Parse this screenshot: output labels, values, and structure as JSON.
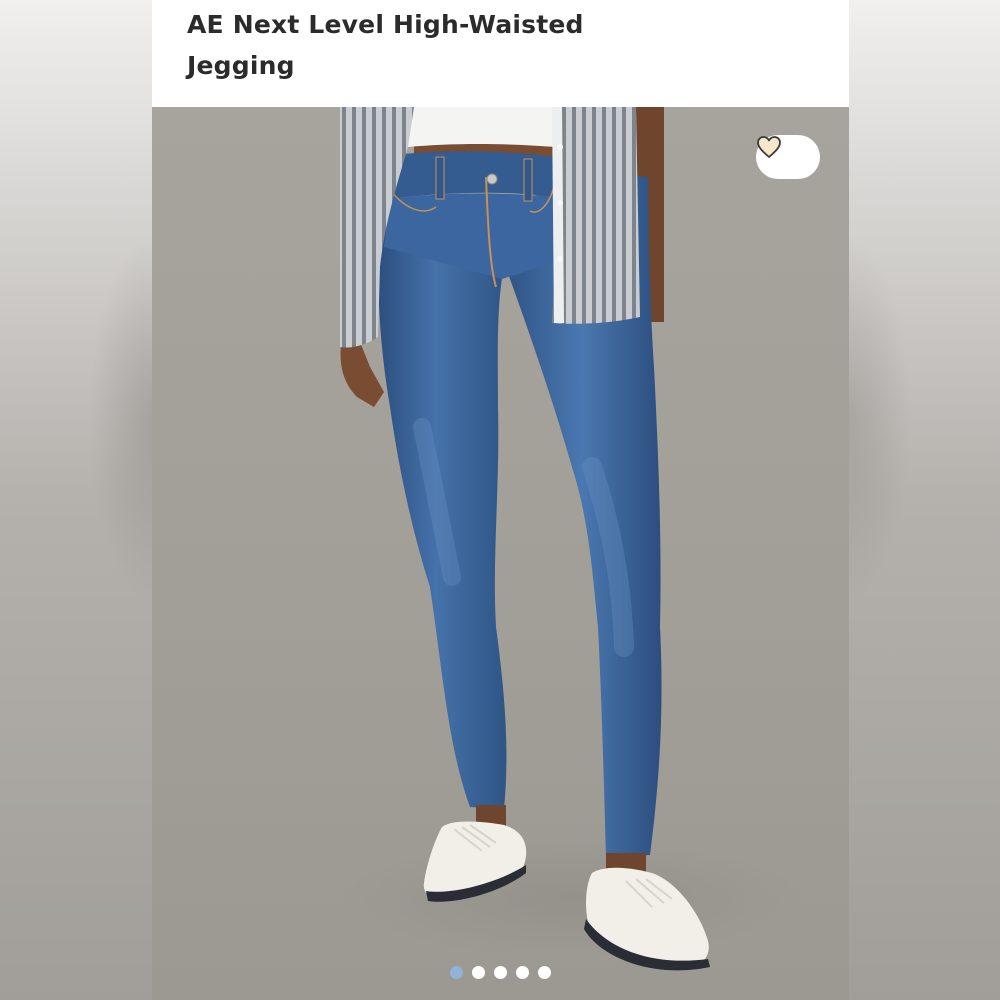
{
  "product": {
    "title": "AE Next Level High-Waisted Jegging"
  },
  "favorite": {
    "icon": "heart-icon",
    "favorited": false
  },
  "gallery": {
    "image_count": 5,
    "active_index": 0,
    "active_dot_color": "#8fb4d4",
    "inactive_dot_color": "#ffffff"
  },
  "colors": {
    "title_text": "#2b2b2b",
    "photo_background": "#a29e98",
    "denim": "#3a639a"
  }
}
